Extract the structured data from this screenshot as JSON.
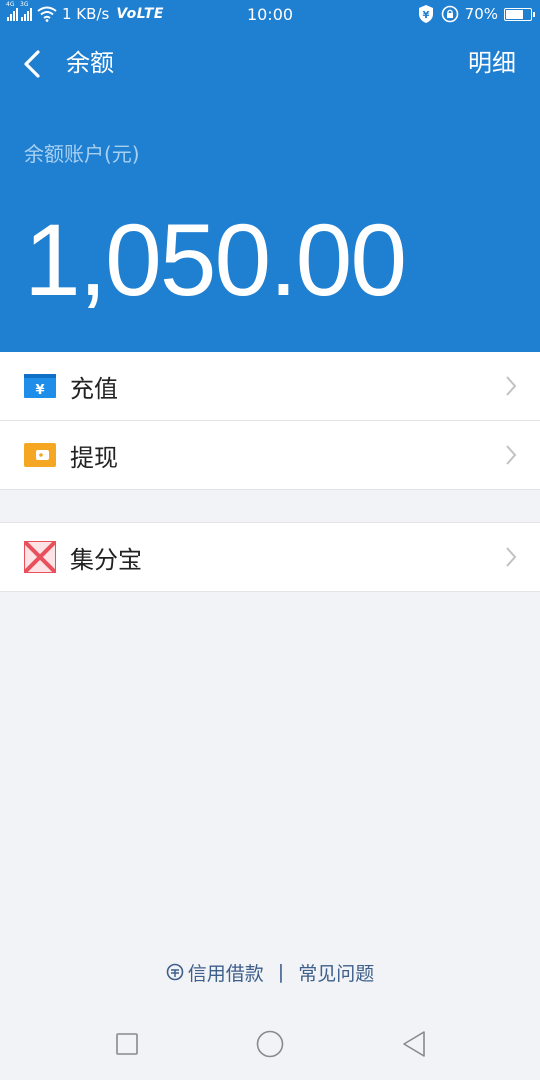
{
  "status_bar": {
    "sim1_tag": "4G",
    "sim2_tag": "3G",
    "speed": "1 KB/s",
    "volte": "VoLTE",
    "time": "10:00",
    "battery_pct": "70%",
    "battery_level": 0.7
  },
  "header": {
    "title": "余额",
    "detail_label": "明细",
    "balance_label": "余额账户(元)",
    "balance_amount": "1,050.00"
  },
  "menu": {
    "items": [
      {
        "label": "充值",
        "icon": "recharge-icon",
        "icon_color": "#1f8ee8"
      },
      {
        "label": "提现",
        "icon": "withdraw-wallet-icon",
        "icon_color": "#f5a623"
      },
      {
        "label": "集分宝",
        "icon": "jifenbao-icon",
        "icon_color": "#e8505b"
      }
    ]
  },
  "footer": {
    "credit_loan": "信用借款",
    "separator": "|",
    "faq": "常见问题"
  },
  "colors": {
    "primary": "#1f7fd1",
    "background": "#f2f3f7",
    "link": "#3d5f8a"
  }
}
